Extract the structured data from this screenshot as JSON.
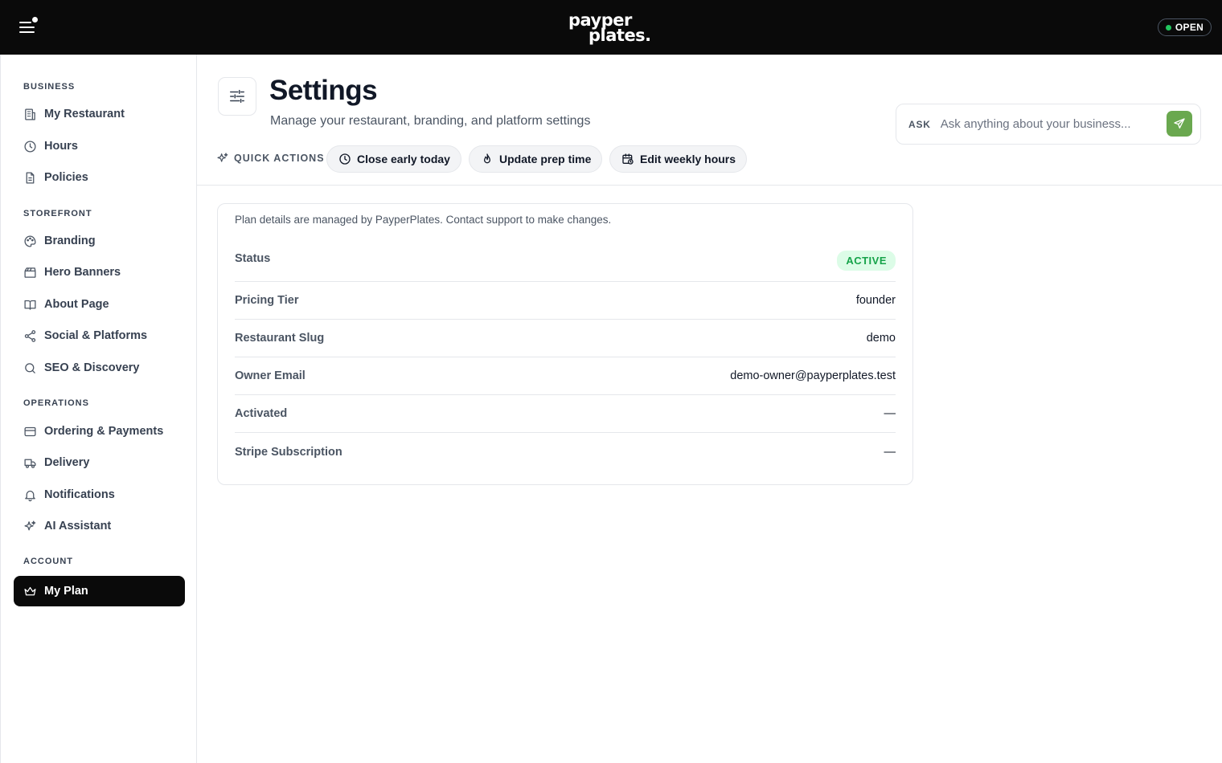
{
  "topbar": {
    "logo_line1": "payper",
    "logo_line2": "plates.",
    "status_label": "OPEN",
    "status_color": "#22c55e"
  },
  "sidebar": {
    "sections": [
      {
        "label": "BUSINESS"
      },
      {
        "label": "STOREFRONT"
      },
      {
        "label": "OPERATIONS"
      },
      {
        "label": "ACCOUNT"
      }
    ],
    "items": [
      {
        "label": "My Restaurant",
        "icon": "building-icon"
      },
      {
        "label": "Hours",
        "icon": "clock-icon"
      },
      {
        "label": "Policies",
        "icon": "document-icon"
      },
      {
        "label": "Branding",
        "icon": "palette-icon"
      },
      {
        "label": "Hero Banners",
        "icon": "banner-icon"
      },
      {
        "label": "About Page",
        "icon": "book-icon"
      },
      {
        "label": "Social & Platforms",
        "icon": "share-icon"
      },
      {
        "label": "SEO & Discovery",
        "icon": "search-icon"
      },
      {
        "label": "Ordering & Payments",
        "icon": "credit-card-icon"
      },
      {
        "label": "Delivery",
        "icon": "truck-icon"
      },
      {
        "label": "Notifications",
        "icon": "bell-icon"
      },
      {
        "label": "AI Assistant",
        "icon": "sparkles-icon"
      },
      {
        "label": "My Plan",
        "icon": "crown-icon",
        "active": true
      }
    ]
  },
  "header": {
    "title": "Settings",
    "subtitle": "Manage your restaurant, branding, and platform settings",
    "quick_actions_label": "QUICK ACTIONS",
    "quick_actions": [
      {
        "label": "Close early today",
        "icon": "clock-icon"
      },
      {
        "label": "Update prep time",
        "icon": "flame-icon"
      },
      {
        "label": "Edit weekly hours",
        "icon": "calendar-icon"
      }
    ],
    "ask": {
      "label": "ASK",
      "placeholder": "Ask anything about your business...",
      "send_color": "#6aa84f"
    }
  },
  "plan": {
    "note": "Plan details are managed by PayperPlates. Contact support to make changes.",
    "status_label": "Status",
    "status_badge": "ACTIVE",
    "badge_bg": "#dcfce7",
    "badge_color": "#16a34a",
    "rows": [
      {
        "label": "Pricing Tier",
        "value": "founder"
      },
      {
        "label": "Restaurant Slug",
        "value": "demo"
      },
      {
        "label": "Owner Email",
        "value": "demo-owner@payperplates.test"
      },
      {
        "label": "Activated",
        "value": "—"
      },
      {
        "label": "Stripe Subscription",
        "value": "—"
      }
    ]
  }
}
